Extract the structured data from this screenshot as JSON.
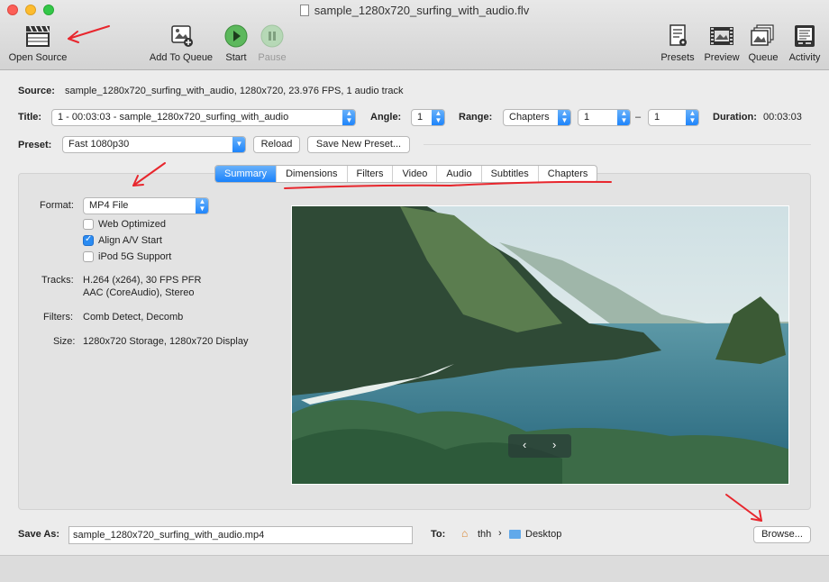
{
  "window": {
    "title": "sample_1280x720_surfing_with_audio.flv"
  },
  "toolbar": {
    "open_source": "Open Source",
    "add_to_queue": "Add To Queue",
    "start": "Start",
    "pause": "Pause",
    "presets": "Presets",
    "preview": "Preview",
    "queue": "Queue",
    "activity": "Activity"
  },
  "source": {
    "label": "Source:",
    "value": "sample_1280x720_surfing_with_audio, 1280x720, 23.976 FPS, 1 audio track"
  },
  "title_row": {
    "label": "Title:",
    "title_value": "1 - 00:03:03 - sample_1280x720_surfing_with_audio",
    "angle_label": "Angle:",
    "angle_value": "1",
    "range_label": "Range:",
    "range_type": "Chapters",
    "range_start": "1",
    "range_dash": "–",
    "range_end": "1",
    "duration_label": "Duration:",
    "duration_value": "00:03:03"
  },
  "preset_row": {
    "label": "Preset:",
    "value": "Fast 1080p30",
    "reload": "Reload",
    "save_new": "Save New Preset..."
  },
  "tabs": [
    "Summary",
    "Dimensions",
    "Filters",
    "Video",
    "Audio",
    "Subtitles",
    "Chapters"
  ],
  "summary": {
    "format_label": "Format:",
    "format_value": "MP4 File",
    "web_optimized": "Web Optimized",
    "align_av": "Align A/V Start",
    "ipod": "iPod 5G Support",
    "tracks_label": "Tracks:",
    "tracks_line1": "H.264 (x264), 30 FPS PFR",
    "tracks_line2": "AAC (CoreAudio), Stereo",
    "filters_label": "Filters:",
    "filters_value": "Comb Detect, Decomb",
    "size_label": "Size:",
    "size_value": "1280x720 Storage, 1280x720 Display",
    "checks": {
      "web_optimized": false,
      "align_av": true,
      "ipod": false
    }
  },
  "preview_nav": {
    "prev": "‹",
    "next": "›"
  },
  "save_as": {
    "label": "Save As:",
    "value": "sample_1280x720_surfing_with_audio.mp4",
    "to_label": "To:",
    "path_home": "thh",
    "path_sep": "›",
    "path_folder": "Desktop",
    "browse": "Browse..."
  },
  "colors": {
    "accent": "#1a82fb",
    "annotation": "#e8262d"
  }
}
